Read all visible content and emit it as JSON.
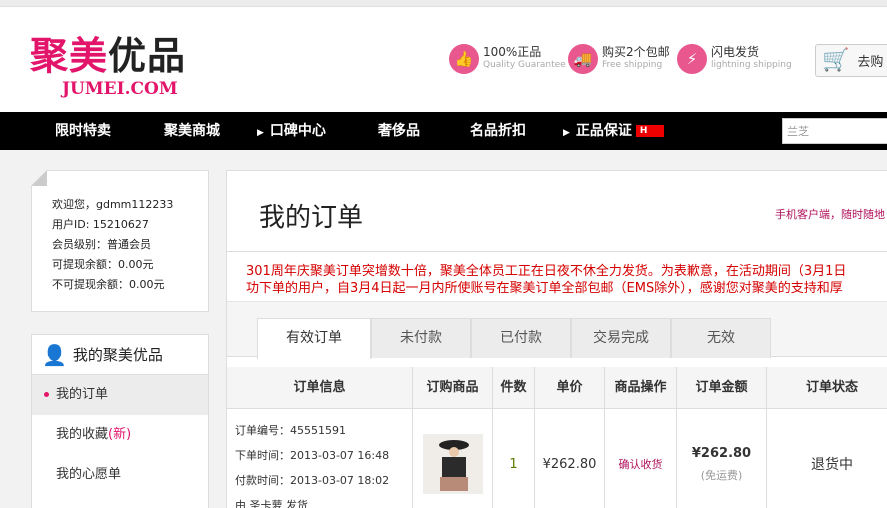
{
  "header": {
    "logo_cn_a": "聚美",
    "logo_cn_b": "优品",
    "logo_en": "JUMEI.COM",
    "promos": [
      {
        "title": "100%正品",
        "sub": "Quality Guarantee",
        "icon": "thumbs-up-icon"
      },
      {
        "title": "购买2个包邮",
        "sub": "Free shipping",
        "icon": "truck-icon"
      },
      {
        "title": "闪电发货",
        "sub": "lightning shipping",
        "icon": "lightning-icon"
      }
    ],
    "cart_label": "去购",
    "accent_color": "#e2156b"
  },
  "nav": {
    "items": [
      "限时特卖",
      "聚美商城",
      "口碑中心",
      "奢侈品",
      "名品折扣",
      "正品保证"
    ],
    "hot_badge": "H",
    "search_value": "兰芝"
  },
  "user": {
    "welcome": "欢迎您，gdmm112233",
    "user_id": "用户ID: 15210627",
    "level": "会员级别：普通会员",
    "withdrawable": "可提现余额：0.00元",
    "non_withdrawable": "不可提现余额：0.00元"
  },
  "sidebar": {
    "title": "我的聚美优品",
    "items": [
      {
        "label": "我的订单"
      },
      {
        "label": "我的收藏",
        "badge": "(新)"
      },
      {
        "label": "我的心愿单"
      }
    ]
  },
  "main": {
    "title": "我的订单",
    "mobile_link": "手机客户端，随时随地",
    "notice_line1": "301周年庆聚美订单突增数十倍，聚美全体员工正在日夜不休全力发货。为表歉意，在活动期间（3月1日",
    "notice_line2": "功下单的用户，自3月4日起一月内所使账号在聚美订单全部包邮（EMS除外），感谢您对聚美的支持和厚",
    "tabs": [
      "有效订单",
      "未付款",
      "已付款",
      "交易完成",
      "无效"
    ],
    "table": {
      "headers": [
        "订单信息",
        "订购商品",
        "件数",
        "单价",
        "商品操作",
        "订单金额",
        "订单状态"
      ],
      "rows": [
        {
          "order_no": "订单编号：45551591",
          "order_time": "下单时间：2013-03-07 16:48",
          "pay_time": "付款时间：2013-03-07 18:02",
          "ship_by": "由 圣卡萝 发货",
          "qty": "1",
          "unit_price": "¥262.80",
          "action": "确认收货",
          "amount": "¥262.80",
          "shipping_note": "(免运费)",
          "status": "退货中"
        }
      ]
    }
  }
}
